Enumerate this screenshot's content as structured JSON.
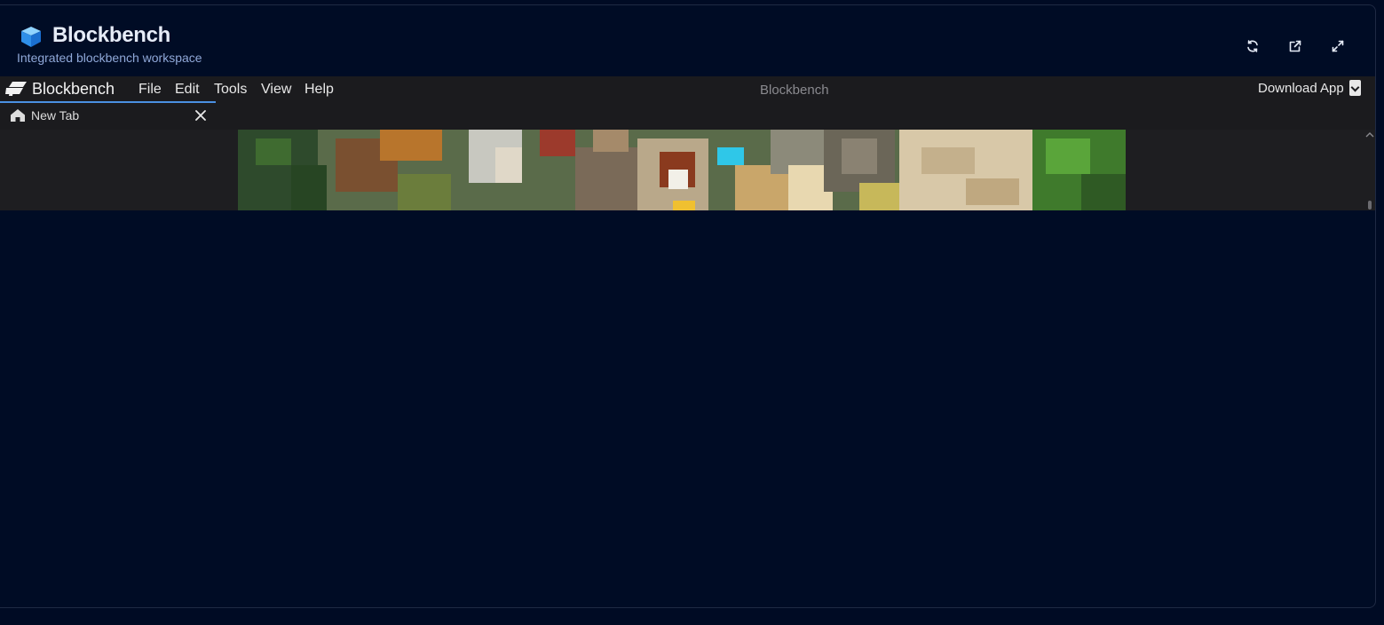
{
  "header": {
    "title": "Blockbench",
    "subtitle": "Integrated blockbench workspace",
    "logo_icon": "cube-icon",
    "actions": [
      {
        "name": "refresh",
        "icon": "refresh-icon"
      },
      {
        "name": "open-external",
        "icon": "external-link-icon"
      },
      {
        "name": "fullscreen",
        "icon": "expand-icon"
      }
    ]
  },
  "app": {
    "brand": "Blockbench",
    "menu": [
      "File",
      "Edit",
      "Tools",
      "View",
      "Help"
    ],
    "title": "Blockbench",
    "download_label": "Download App",
    "download_icon": "download-icon"
  },
  "tabs": [
    {
      "label": "New Tab",
      "icon": "home-icon",
      "close_icon": "close-icon"
    }
  ],
  "colors": {
    "page_background": "#000b24",
    "accent": "#4a90e2",
    "frame_background": "#1f1f22"
  }
}
